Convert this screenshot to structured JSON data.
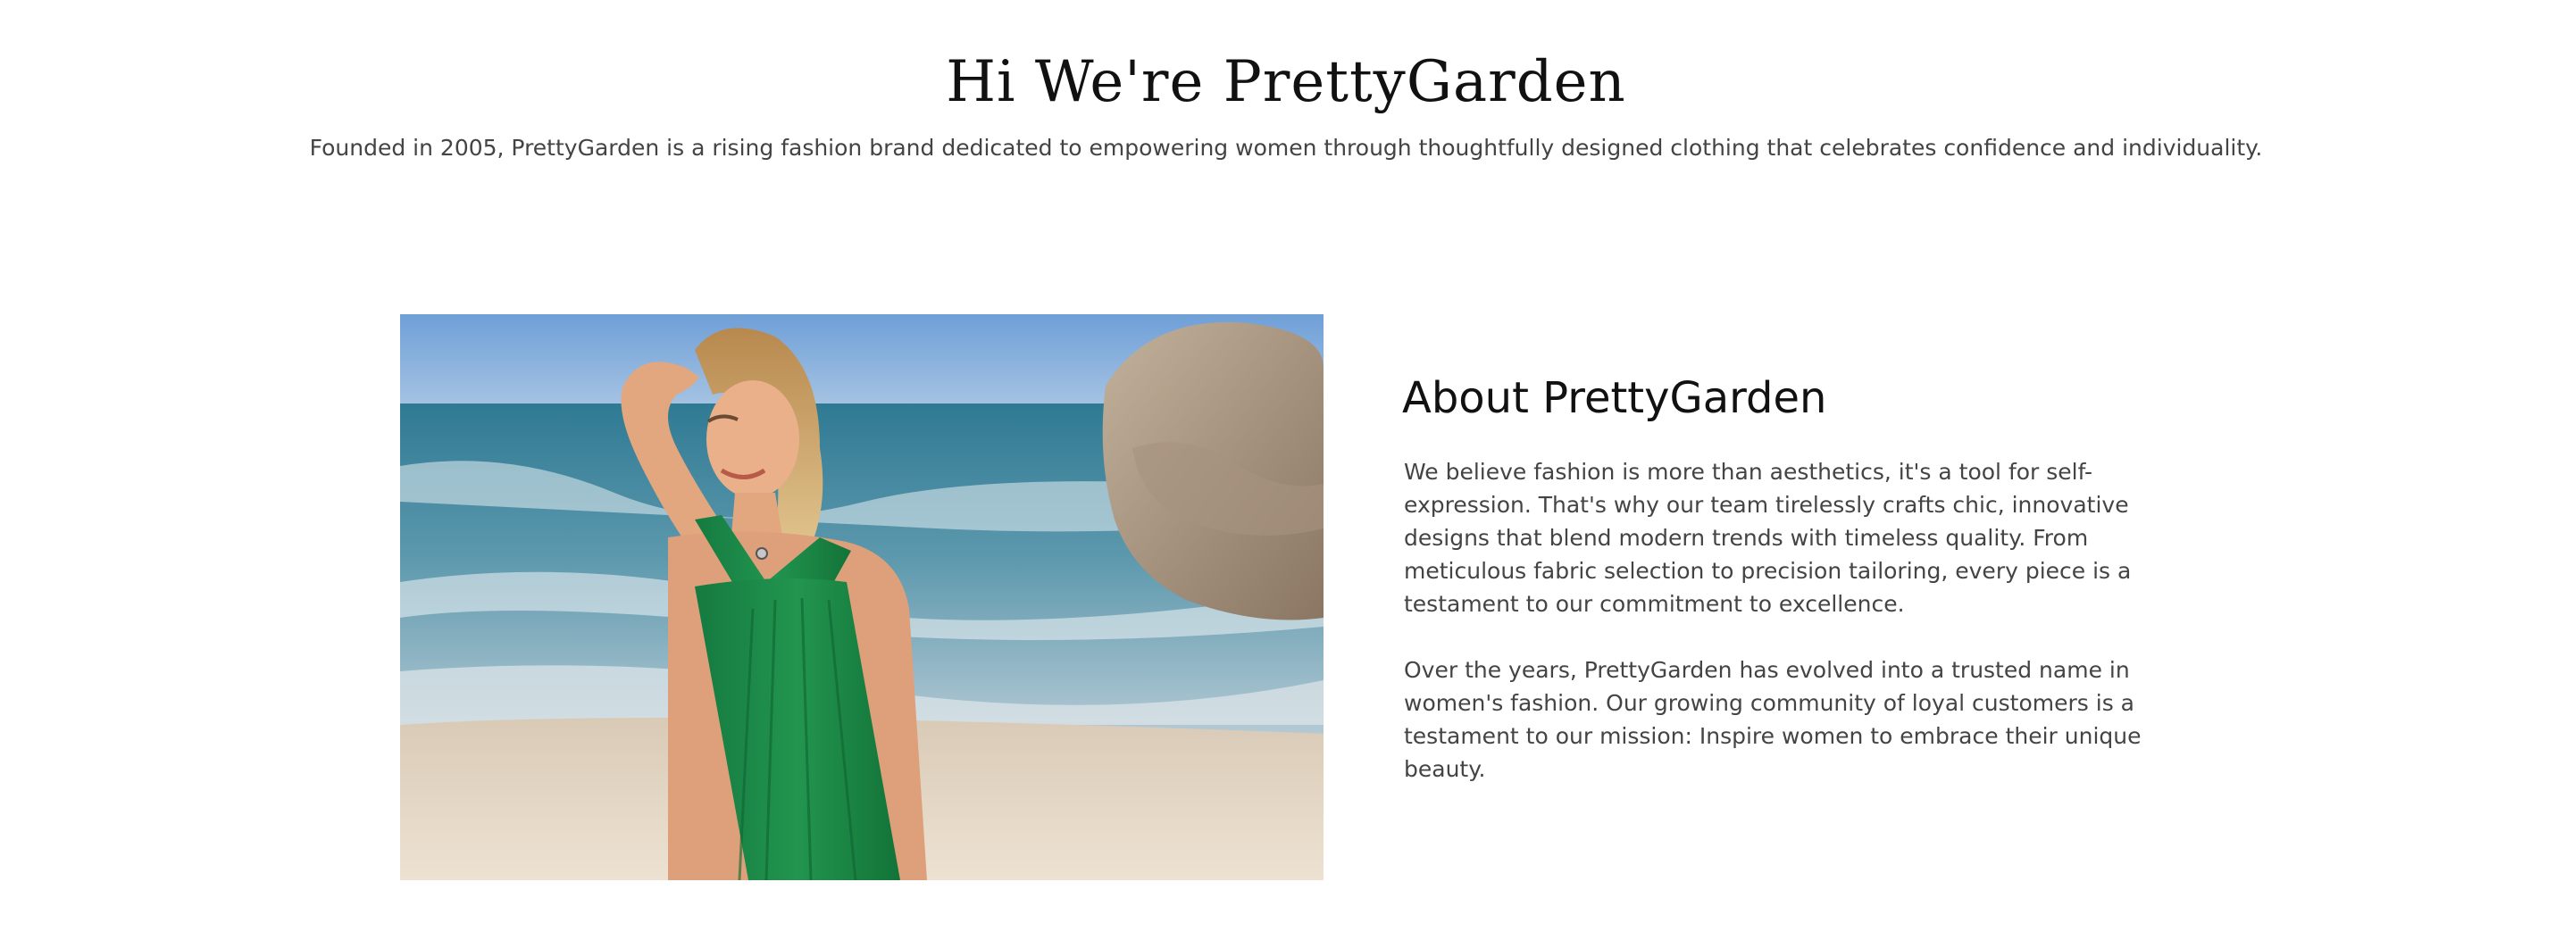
{
  "hero": {
    "title": "Hi We're PrettyGarden",
    "subtitle": "Founded in 2005, PrettyGarden is a rising fashion brand dedicated to empowering women through thoughtfully designed clothing that celebrates confidence and individuality."
  },
  "about": {
    "image": {
      "icon": "beach-model-photo"
    },
    "heading": "About PrettyGarden",
    "paragraphs": [
      "We believe fashion is more than aesthetics, it's a tool for self-expression. That's why our team tirelessly crafts chic, innovative designs that blend modern trends with timeless quality. From meticulous fabric selection to precision tailoring, every piece is a testament to our commitment to excellence.",
      "Over the years, PrettyGarden has evolved into a trusted name in women's fashion. Our growing community of loyal customers is a testament to our mission: Inspire women to embrace their unique beauty."
    ]
  },
  "colors": {
    "heading": "#111111",
    "body_text": "#444444",
    "dress_green": "#1f8a4c",
    "sky": "#7ea6d6",
    "sea": "#3f7f99",
    "sand": "#e4d6c2"
  }
}
